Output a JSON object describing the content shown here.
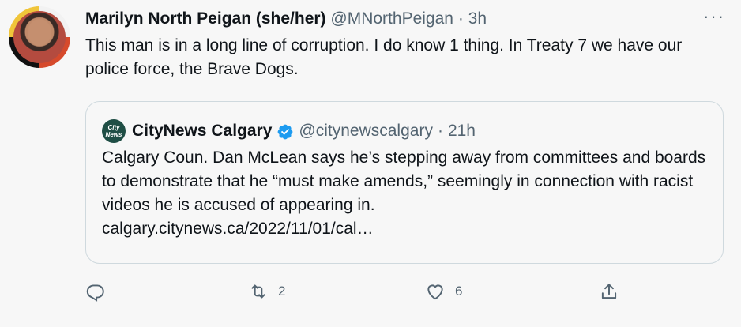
{
  "author": {
    "name": "Marilyn North Peigan (she/her)",
    "handle": "@MNorthPeigan",
    "separator": "·",
    "time": "3h"
  },
  "more_label": "···",
  "tweet_text": "This man is in a long line of corruption. I do know 1 thing. In Treaty 7 we have our police force, the Brave Dogs.",
  "quoted": {
    "logo_line1": "City",
    "logo_line2": "News",
    "name": "CityNews Calgary",
    "handle": "@citynewscalgary",
    "separator": "·",
    "time": "21h",
    "text": "Calgary Coun. Dan McLean says he’s stepping away from committees and boards to demonstrate that he “must make amends,” seemingly in connection with racist videos he is accused of appearing in.",
    "link": "calgary.citynews.ca/2022/11/01/cal…"
  },
  "actions": {
    "reply_icon": "reply-icon",
    "retweet_icon": "retweet-icon",
    "retweet_count": "2",
    "like_icon": "heart-icon",
    "like_count": "6",
    "share_icon": "share-icon"
  },
  "colors": {
    "background": "#f7f7f7",
    "text": "#0f1419",
    "secondary": "#536471",
    "verified": "#1d9bf0",
    "border": "#cfd9de"
  }
}
